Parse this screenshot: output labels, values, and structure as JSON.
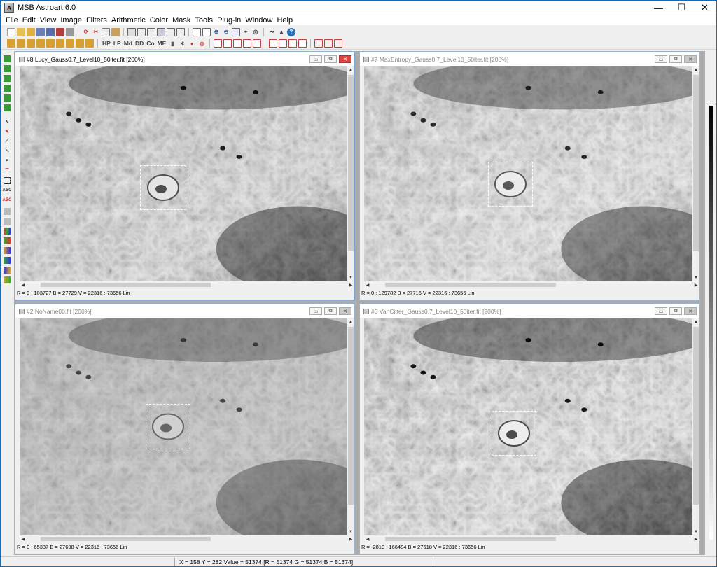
{
  "app": {
    "title": "MSB Astroart 6.0",
    "logo_text": "A",
    "window_controls": {
      "minimize": "—",
      "maximize": "☐",
      "close": "✕"
    }
  },
  "menu": [
    "File",
    "Edit",
    "View",
    "Image",
    "Filters",
    "Arithmetic",
    "Color",
    "Mask",
    "Tools",
    "Plug-in",
    "Window",
    "Help"
  ],
  "toolbar2_labels": {
    "hp": "HP",
    "lp": "LP",
    "md": "Md",
    "dd": "DD",
    "co": "Co",
    "me": "ME"
  },
  "windows": [
    {
      "title": "#8 Lucy_Gauss0.7_Level10_50iter.fit  [200%]",
      "status": "R = 0 : 103727   B = 27729   V = 22316 : 73656 Lin",
      "active": true,
      "contrast": 1.25,
      "brightness": 1.05
    },
    {
      "title": "#7 MaxEntropy_Gauss0.7_Level10_50iter.fit  [200%]",
      "status": "R = 0 : 129782   B = 27716   V = 22316 : 73656 Lin",
      "active": false,
      "contrast": 1.15,
      "brightness": 1.12
    },
    {
      "title": "#2 NoName00.fit  [200%]",
      "status": "R = 0 : 65337   B = 27698   V = 22316 : 73656 Lin",
      "active": false,
      "contrast": 0.85,
      "brightness": 1.1
    },
    {
      "title": "#6 VanCitter_Gauss0.7_Level10_50iter.fit  [200%]",
      "status": "R = -2810 : 166484   B = 27618   V = 22316 : 73656 Lin",
      "active": false,
      "contrast": 1.35,
      "brightness": 1.05
    }
  ],
  "window_buttons": {
    "minimize": "▭",
    "restore": "⧉",
    "close": "✕"
  },
  "scroll_arrows": {
    "up": "▲",
    "down": "▼",
    "left": "◀",
    "right": "▶"
  },
  "statusbar": {
    "text": "X = 158   Y = 282   Value = 51374  [R = 51374  G = 51374  B = 51374]"
  },
  "colors": {
    "active_title_accent": "#e04343",
    "frame": "#1a6ab0"
  }
}
